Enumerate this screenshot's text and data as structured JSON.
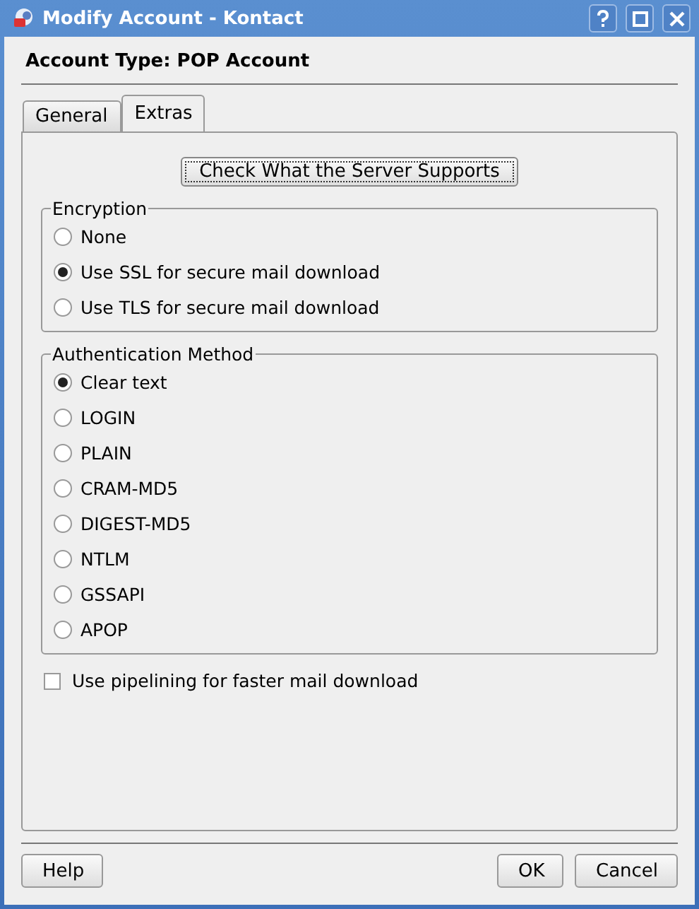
{
  "window": {
    "title": "Modify Account - Kontact"
  },
  "header": "Account Type: POP Account",
  "tabs": [
    {
      "label": "General",
      "selected": false
    },
    {
      "label": "Extras",
      "selected": true
    }
  ],
  "check_button": {
    "label": "Check What the Server Supports"
  },
  "encryption": {
    "title": "Encryption",
    "options": [
      {
        "label": "None",
        "selected": false
      },
      {
        "label": "Use SSL for secure mail download",
        "selected": true
      },
      {
        "label": "Use TLS for secure mail download",
        "selected": false
      }
    ]
  },
  "authentication": {
    "title": "Authentication Method",
    "options": [
      {
        "label": "Clear text",
        "selected": true
      },
      {
        "label": "LOGIN",
        "selected": false
      },
      {
        "label": "PLAIN",
        "selected": false
      },
      {
        "label": "CRAM-MD5",
        "selected": false
      },
      {
        "label": "DIGEST-MD5",
        "selected": false
      },
      {
        "label": "NTLM",
        "selected": false
      },
      {
        "label": "GSSAPI",
        "selected": false
      },
      {
        "label": "APOP",
        "selected": false
      }
    ]
  },
  "pipelining": {
    "label": "Use pipelining for faster mail download",
    "checked": false
  },
  "buttons": [
    {
      "label": "Help",
      "kind": "left"
    },
    {
      "label": "OK",
      "kind": "right"
    },
    {
      "label": "Cancel",
      "kind": "right"
    }
  ]
}
